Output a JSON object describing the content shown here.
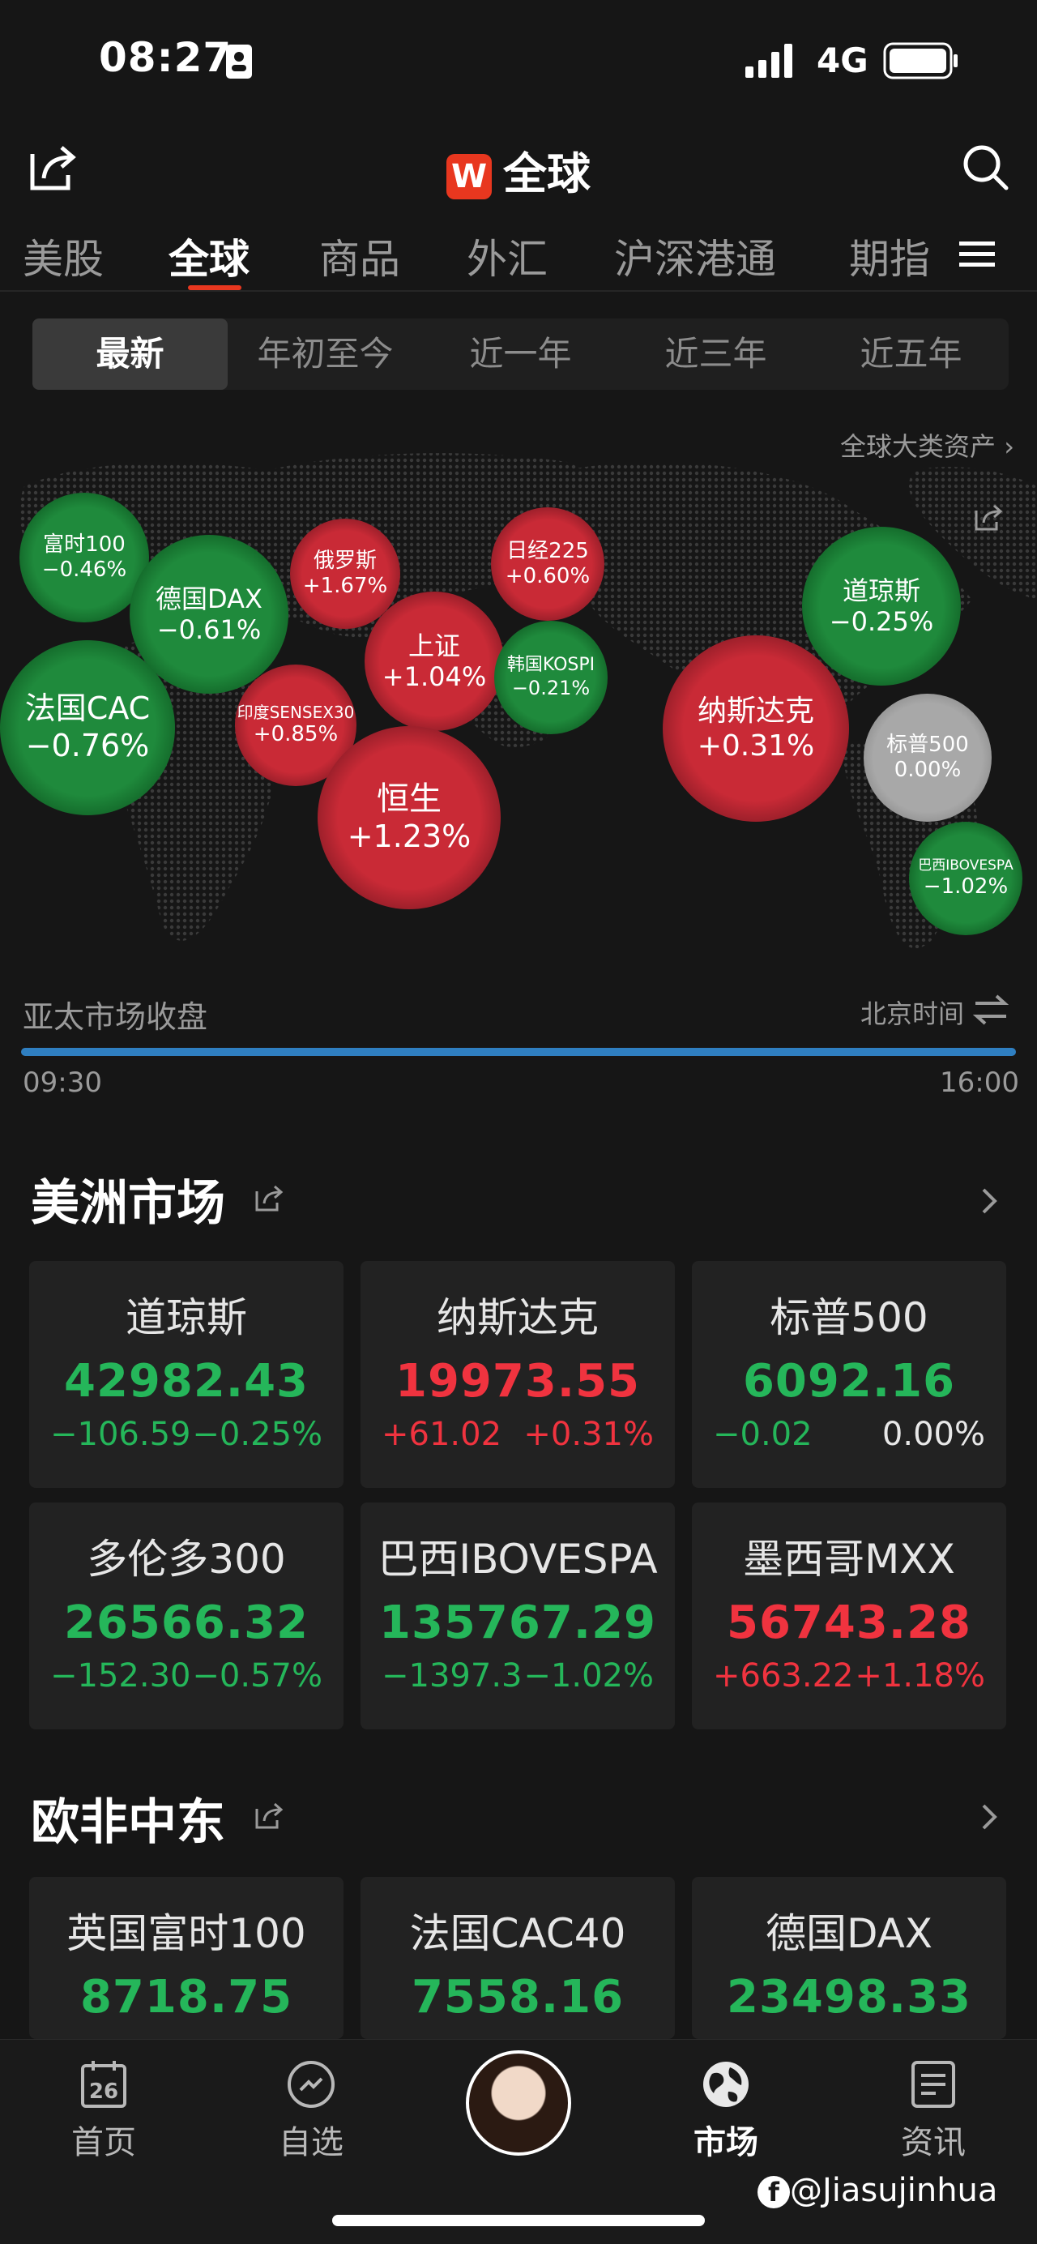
{
  "status_bar": {
    "time": "08:27",
    "network": "4G"
  },
  "header": {
    "logo_letter": "W",
    "title": "全球"
  },
  "tabs": [
    {
      "label": "美股",
      "active": false
    },
    {
      "label": "全球",
      "active": true
    },
    {
      "label": "商品",
      "active": false
    },
    {
      "label": "外汇",
      "active": false
    },
    {
      "label": "沪深港通",
      "active": false
    },
    {
      "label": "期指",
      "active": false
    }
  ],
  "periods": [
    {
      "label": "最新",
      "selected": true
    },
    {
      "label": "年初至今",
      "selected": false
    },
    {
      "label": "近一年",
      "selected": false
    },
    {
      "label": "近三年",
      "selected": false
    },
    {
      "label": "近五年",
      "selected": false
    }
  ],
  "map": {
    "asset_link": "全球大类资产 ›",
    "bubbles": [
      {
        "name": "富时100",
        "change": "−0.46%",
        "color": "green"
      },
      {
        "name": "德国DAX",
        "change": "−0.61%",
        "color": "green"
      },
      {
        "name": "俄罗斯",
        "change": "+1.67%",
        "color": "red"
      },
      {
        "name": "日经225",
        "change": "+0.60%",
        "color": "red"
      },
      {
        "name": "道琼斯",
        "change": "−0.25%",
        "color": "green"
      },
      {
        "name": "法国CAC",
        "change": "−0.76%",
        "color": "green"
      },
      {
        "name": "印度SENSEX30",
        "change": "+0.85%",
        "color": "red"
      },
      {
        "name": "上证",
        "change": "+1.04%",
        "color": "red"
      },
      {
        "name": "韩国KOSPI",
        "change": "−0.21%",
        "color": "green"
      },
      {
        "name": "纳斯达克",
        "change": "+0.31%",
        "color": "red"
      },
      {
        "name": "标普500",
        "change": "0.00%",
        "color": "grey"
      },
      {
        "name": "恒生",
        "change": "+1.23%",
        "color": "red"
      },
      {
        "name": "巴西IBOVESPA",
        "change": "−1.02%",
        "color": "green"
      }
    ]
  },
  "session": {
    "label": "亚太市场收盘",
    "timezone": "北京时间",
    "start": "09:30",
    "end": "16:00",
    "progress": 1.0
  },
  "americas": {
    "title": "美洲市场",
    "cards": [
      {
        "name": "道琼斯",
        "price": "42982.43",
        "change": "−106.59",
        "pct": "−0.25%",
        "color": "green",
        "pct_color": "green"
      },
      {
        "name": "纳斯达克",
        "price": "19973.55",
        "change": "+61.02",
        "pct": "+0.31%",
        "color": "red",
        "pct_color": "red"
      },
      {
        "name": "标普500",
        "price": "6092.16",
        "change": "−0.02",
        "pct": "0.00%",
        "color": "green",
        "pct_color": "white"
      },
      {
        "name": "多伦多300",
        "price": "26566.32",
        "change": "−152.30",
        "pct": "−0.57%",
        "color": "green",
        "pct_color": "green"
      },
      {
        "name": "巴西IBOVESPA",
        "price": "135767.29",
        "change": "−1397.3",
        "pct": "−1.02%",
        "color": "green",
        "pct_color": "green"
      },
      {
        "name": "墨西哥MXX",
        "price": "56743.28",
        "change": "+663.22",
        "pct": "+1.18%",
        "color": "red",
        "pct_color": "red"
      }
    ]
  },
  "emea": {
    "title": "欧非中东",
    "cards": [
      {
        "name": "英国富时100",
        "price": "8718.75",
        "color": "green"
      },
      {
        "name": "法国CAC40",
        "price": "7558.16",
        "color": "green"
      },
      {
        "name": "德国DAX",
        "price": "23498.33",
        "color": "green"
      }
    ]
  },
  "bottom_nav": [
    {
      "label": "首页",
      "icon": "calendar-icon",
      "date": "26"
    },
    {
      "label": "自选",
      "icon": "compass-icon"
    },
    {
      "label": "市场",
      "icon": "globe-icon",
      "active": true
    },
    {
      "label": "资讯",
      "icon": "news-icon"
    }
  ],
  "watermark": "@Jiasujinhua"
}
